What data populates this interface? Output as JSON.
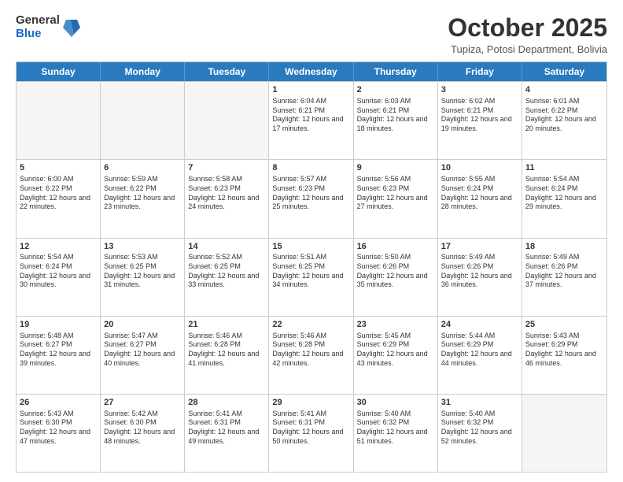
{
  "logo": {
    "general": "General",
    "blue": "Blue"
  },
  "header": {
    "month": "October 2025",
    "location": "Tupiza, Potosi Department, Bolivia"
  },
  "weekdays": [
    "Sunday",
    "Monday",
    "Tuesday",
    "Wednesday",
    "Thursday",
    "Friday",
    "Saturday"
  ],
  "rows": [
    [
      {
        "day": "",
        "sunrise": "",
        "sunset": "",
        "daylight": "",
        "empty": true
      },
      {
        "day": "",
        "sunrise": "",
        "sunset": "",
        "daylight": "",
        "empty": true
      },
      {
        "day": "",
        "sunrise": "",
        "sunset": "",
        "daylight": "",
        "empty": true
      },
      {
        "day": "1",
        "sunrise": "Sunrise: 6:04 AM",
        "sunset": "Sunset: 6:21 PM",
        "daylight": "Daylight: 12 hours and 17 minutes.",
        "empty": false
      },
      {
        "day": "2",
        "sunrise": "Sunrise: 6:03 AM",
        "sunset": "Sunset: 6:21 PM",
        "daylight": "Daylight: 12 hours and 18 minutes.",
        "empty": false
      },
      {
        "day": "3",
        "sunrise": "Sunrise: 6:02 AM",
        "sunset": "Sunset: 6:21 PM",
        "daylight": "Daylight: 12 hours and 19 minutes.",
        "empty": false
      },
      {
        "day": "4",
        "sunrise": "Sunrise: 6:01 AM",
        "sunset": "Sunset: 6:22 PM",
        "daylight": "Daylight: 12 hours and 20 minutes.",
        "empty": false
      }
    ],
    [
      {
        "day": "5",
        "sunrise": "Sunrise: 6:00 AM",
        "sunset": "Sunset: 6:22 PM",
        "daylight": "Daylight: 12 hours and 22 minutes.",
        "empty": false
      },
      {
        "day": "6",
        "sunrise": "Sunrise: 5:59 AM",
        "sunset": "Sunset: 6:22 PM",
        "daylight": "Daylight: 12 hours and 23 minutes.",
        "empty": false
      },
      {
        "day": "7",
        "sunrise": "Sunrise: 5:58 AM",
        "sunset": "Sunset: 6:23 PM",
        "daylight": "Daylight: 12 hours and 24 minutes.",
        "empty": false
      },
      {
        "day": "8",
        "sunrise": "Sunrise: 5:57 AM",
        "sunset": "Sunset: 6:23 PM",
        "daylight": "Daylight: 12 hours and 25 minutes.",
        "empty": false
      },
      {
        "day": "9",
        "sunrise": "Sunrise: 5:56 AM",
        "sunset": "Sunset: 6:23 PM",
        "daylight": "Daylight: 12 hours and 27 minutes.",
        "empty": false
      },
      {
        "day": "10",
        "sunrise": "Sunrise: 5:55 AM",
        "sunset": "Sunset: 6:24 PM",
        "daylight": "Daylight: 12 hours and 28 minutes.",
        "empty": false
      },
      {
        "day": "11",
        "sunrise": "Sunrise: 5:54 AM",
        "sunset": "Sunset: 6:24 PM",
        "daylight": "Daylight: 12 hours and 29 minutes.",
        "empty": false
      }
    ],
    [
      {
        "day": "12",
        "sunrise": "Sunrise: 5:54 AM",
        "sunset": "Sunset: 6:24 PM",
        "daylight": "Daylight: 12 hours and 30 minutes.",
        "empty": false
      },
      {
        "day": "13",
        "sunrise": "Sunrise: 5:53 AM",
        "sunset": "Sunset: 6:25 PM",
        "daylight": "Daylight: 12 hours and 31 minutes.",
        "empty": false
      },
      {
        "day": "14",
        "sunrise": "Sunrise: 5:52 AM",
        "sunset": "Sunset: 6:25 PM",
        "daylight": "Daylight: 12 hours and 33 minutes.",
        "empty": false
      },
      {
        "day": "15",
        "sunrise": "Sunrise: 5:51 AM",
        "sunset": "Sunset: 6:25 PM",
        "daylight": "Daylight: 12 hours and 34 minutes.",
        "empty": false
      },
      {
        "day": "16",
        "sunrise": "Sunrise: 5:50 AM",
        "sunset": "Sunset: 6:26 PM",
        "daylight": "Daylight: 12 hours and 35 minutes.",
        "empty": false
      },
      {
        "day": "17",
        "sunrise": "Sunrise: 5:49 AM",
        "sunset": "Sunset: 6:26 PM",
        "daylight": "Daylight: 12 hours and 36 minutes.",
        "empty": false
      },
      {
        "day": "18",
        "sunrise": "Sunrise: 5:49 AM",
        "sunset": "Sunset: 6:26 PM",
        "daylight": "Daylight: 12 hours and 37 minutes.",
        "empty": false
      }
    ],
    [
      {
        "day": "19",
        "sunrise": "Sunrise: 5:48 AM",
        "sunset": "Sunset: 6:27 PM",
        "daylight": "Daylight: 12 hours and 39 minutes.",
        "empty": false
      },
      {
        "day": "20",
        "sunrise": "Sunrise: 5:47 AM",
        "sunset": "Sunset: 6:27 PM",
        "daylight": "Daylight: 12 hours and 40 minutes.",
        "empty": false
      },
      {
        "day": "21",
        "sunrise": "Sunrise: 5:46 AM",
        "sunset": "Sunset: 6:28 PM",
        "daylight": "Daylight: 12 hours and 41 minutes.",
        "empty": false
      },
      {
        "day": "22",
        "sunrise": "Sunrise: 5:46 AM",
        "sunset": "Sunset: 6:28 PM",
        "daylight": "Daylight: 12 hours and 42 minutes.",
        "empty": false
      },
      {
        "day": "23",
        "sunrise": "Sunrise: 5:45 AM",
        "sunset": "Sunset: 6:29 PM",
        "daylight": "Daylight: 12 hours and 43 minutes.",
        "empty": false
      },
      {
        "day": "24",
        "sunrise": "Sunrise: 5:44 AM",
        "sunset": "Sunset: 6:29 PM",
        "daylight": "Daylight: 12 hours and 44 minutes.",
        "empty": false
      },
      {
        "day": "25",
        "sunrise": "Sunrise: 5:43 AM",
        "sunset": "Sunset: 6:29 PM",
        "daylight": "Daylight: 12 hours and 46 minutes.",
        "empty": false
      }
    ],
    [
      {
        "day": "26",
        "sunrise": "Sunrise: 5:43 AM",
        "sunset": "Sunset: 6:30 PM",
        "daylight": "Daylight: 12 hours and 47 minutes.",
        "empty": false
      },
      {
        "day": "27",
        "sunrise": "Sunrise: 5:42 AM",
        "sunset": "Sunset: 6:30 PM",
        "daylight": "Daylight: 12 hours and 48 minutes.",
        "empty": false
      },
      {
        "day": "28",
        "sunrise": "Sunrise: 5:41 AM",
        "sunset": "Sunset: 6:31 PM",
        "daylight": "Daylight: 12 hours and 49 minutes.",
        "empty": false
      },
      {
        "day": "29",
        "sunrise": "Sunrise: 5:41 AM",
        "sunset": "Sunset: 6:31 PM",
        "daylight": "Daylight: 12 hours and 50 minutes.",
        "empty": false
      },
      {
        "day": "30",
        "sunrise": "Sunrise: 5:40 AM",
        "sunset": "Sunset: 6:32 PM",
        "daylight": "Daylight: 12 hours and 51 minutes.",
        "empty": false
      },
      {
        "day": "31",
        "sunrise": "Sunrise: 5:40 AM",
        "sunset": "Sunset: 6:32 PM",
        "daylight": "Daylight: 12 hours and 52 minutes.",
        "empty": false
      },
      {
        "day": "",
        "sunrise": "",
        "sunset": "",
        "daylight": "",
        "empty": true
      }
    ]
  ]
}
